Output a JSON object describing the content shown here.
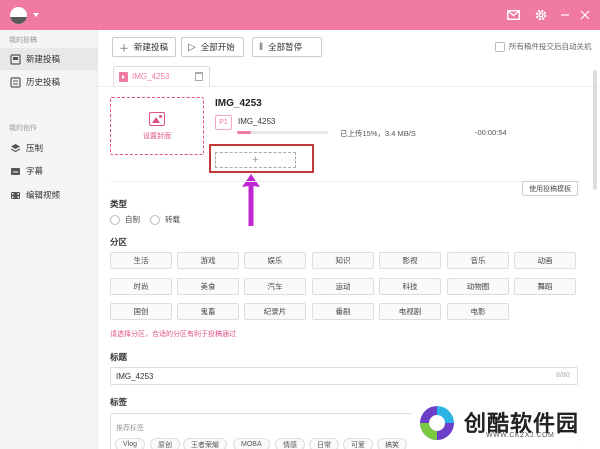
{
  "titlebar": {
    "icons": [
      "app-logo",
      "mail-icon",
      "gear-icon",
      "minimize-icon",
      "close-icon"
    ]
  },
  "sidebar": {
    "section1": "我的投稿",
    "items1": [
      {
        "label": "新建投稿",
        "icon": "upload-icon",
        "active": true
      },
      {
        "label": "历史投稿",
        "icon": "history-icon",
        "active": false
      }
    ],
    "section2": "我的创作",
    "items2": [
      {
        "label": "压制",
        "icon": "layers-icon"
      },
      {
        "label": "字幕",
        "icon": "subtitle-icon"
      },
      {
        "label": "编辑视频",
        "icon": "film-icon"
      }
    ]
  },
  "toolbar": {
    "new_label": "新建投稿",
    "start_all_label": "全部开始",
    "pause_all_label": "全部暂停",
    "auto_shutdown_label": "所有稿件投交后自动关机"
  },
  "file_tab": {
    "name": "IMG_4253"
  },
  "upload": {
    "cover_label": "设置封面",
    "video_title": "IMG_4253",
    "part_badge": "P1",
    "part_name": "IMG_4253",
    "progress_percent": 15,
    "status": "已上传15%，3.4 MB/S",
    "time_left": "-00:00:54",
    "add_part_symbol": "+"
  },
  "template_button": "使用投稿模板",
  "type_section": {
    "label": "类型",
    "options": [
      "自制",
      "转载"
    ]
  },
  "zone_section": {
    "label": "分区",
    "rows": [
      [
        "生活",
        "游戏",
        "娱乐",
        "知识",
        "影视",
        "音乐",
        "动画"
      ],
      [
        "时尚",
        "美食",
        "汽车",
        "运动",
        "科技",
        "动物圈",
        "舞蹈"
      ],
      [
        "国创",
        "鬼畜",
        "纪录片",
        "番剧",
        "电视剧",
        "电影"
      ]
    ],
    "hint": "请选择分区，合适的分区有利于投稿通过"
  },
  "title_section": {
    "label": "标题",
    "value": "IMG_4253",
    "count": "8/80"
  },
  "tags_section": {
    "label": "标签",
    "hint": "推荐标签",
    "chips": [
      "Vlog",
      "原创",
      "王者荣耀",
      "MOBA",
      "情感",
      "日常",
      "可爱",
      "搞笑"
    ]
  },
  "watermark": {
    "brand": "创酷软件园",
    "url": "WWW.CKZXJ.COM"
  },
  "colors": {
    "accent": "#f07aa0",
    "accent_dark": "#e0508a",
    "highlight_box": "#c23a3a",
    "arrow": "#c026d3"
  }
}
